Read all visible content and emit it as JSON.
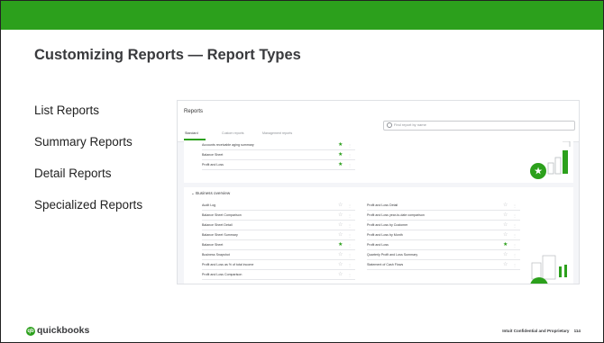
{
  "slide": {
    "title": "Customizing Reports — Report Types",
    "bullets": [
      "List Reports",
      "Summary Reports",
      "Detail Reports",
      "Specialized Reports"
    ],
    "footer": "Intuit Confidential and Proprietary",
    "page_number": "114",
    "brand": {
      "logo_text": "quickbooks",
      "logo_mark": "qb",
      "accent_color": "#2ca01c"
    }
  },
  "screenshot": {
    "title": "Reports",
    "search_placeholder": "Find report by name",
    "tabs": [
      "Standard",
      "Custom reports",
      "Management reports"
    ],
    "active_tab": "Standard",
    "favorites": [
      {
        "label": "Accounts receivable aging summary",
        "starred": true
      },
      {
        "label": "Balance Sheet",
        "starred": true
      },
      {
        "label": "Profit and Loss",
        "starred": true
      }
    ],
    "section_title": "Business overview",
    "left_column": [
      {
        "label": "Audit Log",
        "starred": false
      },
      {
        "label": "Balance Sheet Comparison",
        "starred": false
      },
      {
        "label": "Balance Sheet Detail",
        "starred": false
      },
      {
        "label": "Balance Sheet Summary",
        "starred": false
      },
      {
        "label": "Balance Sheet",
        "starred": true
      },
      {
        "label": "Business Snapshot",
        "starred": false
      },
      {
        "label": "Profit and Loss as % of total income",
        "starred": false
      },
      {
        "label": "Profit and Loss Comparison",
        "starred": false
      }
    ],
    "right_column": [
      {
        "label": "Profit and Loss Detail",
        "starred": false
      },
      {
        "label": "Profit and Loss year-to-date comparison",
        "starred": false
      },
      {
        "label": "Profit and Loss by Customer",
        "starred": false
      },
      {
        "label": "Profit and Loss by Month",
        "starred": false
      },
      {
        "label": "Profit and Loss",
        "starred": true
      },
      {
        "label": "Quarterly Profit and Loss Summary",
        "starred": false
      },
      {
        "label": "Statement of Cash Flows",
        "starred": false
      }
    ]
  }
}
